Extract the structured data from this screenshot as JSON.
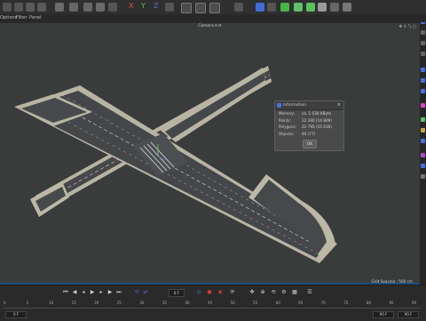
{
  "menubar": {
    "items": [
      "Options",
      "Filter",
      "Panel"
    ]
  },
  "toolbar": {
    "axis_labels": [
      "X",
      "Y",
      "Z"
    ]
  },
  "viewport": {
    "camera_label": "Camera ▾ ⟳",
    "grid_spacing": "Grid Spacing : 500 cm"
  },
  "info_dialog": {
    "title": "Information",
    "rows": [
      {
        "key": "Memory:",
        "value": "ca. 1 030 KByte"
      },
      {
        "key": "Points:",
        "value": "22 390 (14 809)"
      },
      {
        "key": "Polygons:",
        "value": "22 795 (15 616)"
      },
      {
        "key": "Objects:",
        "value": "40 (77)"
      }
    ],
    "ok_label": "OK"
  },
  "timeline": {
    "current_frame": "0 F",
    "ticks": [
      "0",
      "5",
      "10",
      "15",
      "20",
      "25",
      "30",
      "35",
      "40",
      "45",
      "50",
      "55",
      "60",
      "65",
      "70",
      "75",
      "80",
      "85",
      "90"
    ],
    "start_frame": "0 F",
    "end_frame": "90 F",
    "min_frame": "90 F",
    "max_frame": "90 F"
  },
  "colors": {
    "accent": "#4b70d8",
    "record": "#d23a3a",
    "ruler": "#1f4d7a"
  }
}
